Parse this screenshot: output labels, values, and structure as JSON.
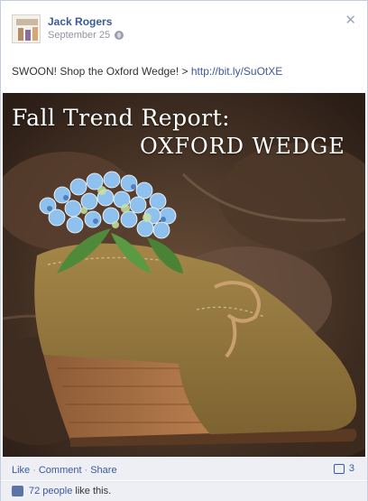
{
  "post": {
    "author": "Jack Rogers",
    "date": "September 25",
    "privacy_icon": "globe-icon",
    "message_text": "SWOON! Shop the Oxford Wedge! > ",
    "message_link": "http://bit.ly/SuOtXE",
    "photo": {
      "title": "Fall Trend Report:",
      "subtitle": "OXFORD WEDGE"
    }
  },
  "actions": {
    "like": "Like",
    "comment": "Comment",
    "share": "Share",
    "separator": "·",
    "comment_count": "3"
  },
  "likes": {
    "count": "72 people",
    "suffix": "like this."
  },
  "colors": {
    "link": "#3b5998",
    "footer_bg": "#edeff4"
  }
}
